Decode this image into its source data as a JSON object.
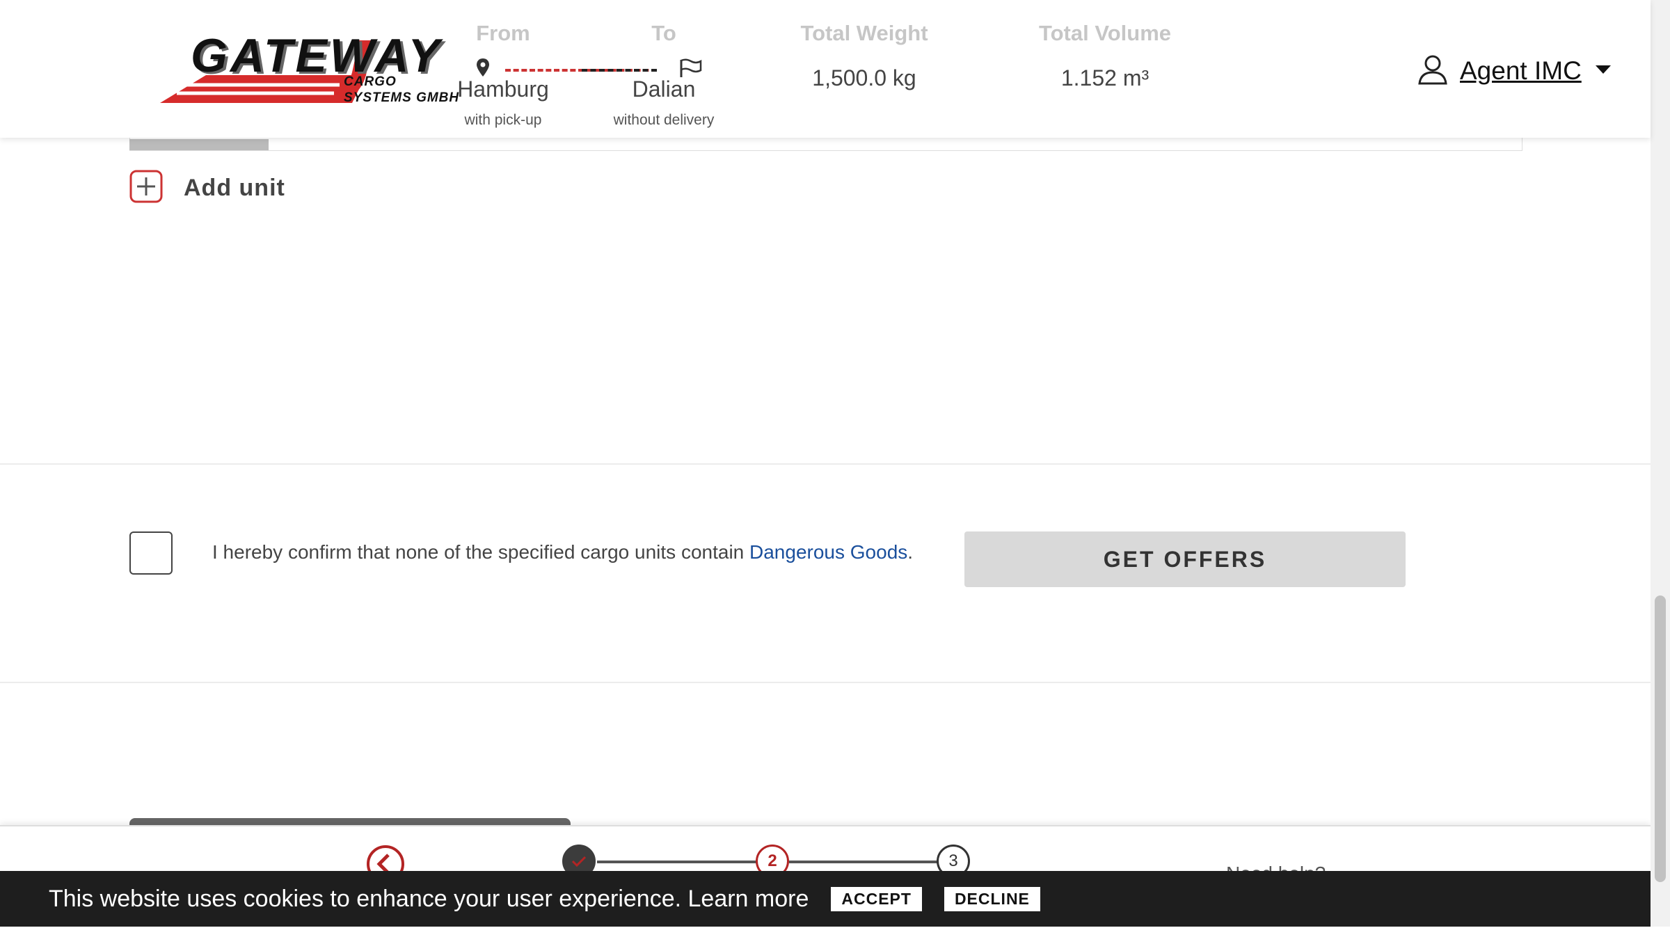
{
  "header": {
    "logo": {
      "main": "GATEWAY",
      "sub_line1": "CARGO",
      "sub_line2": "SYSTEMS GMBH"
    },
    "from": {
      "label": "From",
      "city": "Hamburg",
      "note": "with pick-up"
    },
    "to": {
      "label": "To",
      "city": "Dalian",
      "note": "without delivery"
    },
    "total_weight": {
      "label": "Total Weight",
      "value": "1,500.0 kg"
    },
    "total_volume": {
      "label": "Total Volume",
      "value": "1.152 m³"
    },
    "user": {
      "name": "Agent IMC",
      "icon": "user-icon"
    }
  },
  "units": {
    "add_label": "Add unit",
    "add_icon": "plus-square-icon"
  },
  "confirm": {
    "text": "I hereby confirm that none of the specified cargo units contain ",
    "link": "Dangerous Goods",
    "suffix": ".",
    "checked": false
  },
  "actions": {
    "get_offers": "GET OFFERS"
  },
  "stepper": {
    "steps": [
      {
        "label": "",
        "state": "done"
      },
      {
        "label": "2",
        "state": "active"
      },
      {
        "label": "3",
        "state": "pending"
      }
    ],
    "back_icon": "chevron-left-icon",
    "help": "Need help?"
  },
  "cookie": {
    "message": "This website uses cookies to enhance your user experience. Learn more",
    "accept": "ACCEPT",
    "decline": "DECLINE"
  },
  "colors": {
    "brand_red": "#cc2a2a",
    "link_blue": "#1a4f9c",
    "cookie_bg": "#1e1e1e"
  }
}
